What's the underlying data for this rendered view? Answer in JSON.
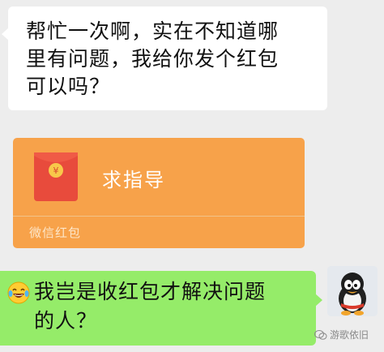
{
  "messages": {
    "incoming_text": "帮忙一次啊，实在不知道哪\n里有问题，我给你发个红包\n可以吗？",
    "red_packet": {
      "title": "求指导",
      "footer": "微信红包",
      "icon": "red-envelope-icon",
      "colors": {
        "card": "#f7a24a",
        "envelope": "#e84b3c",
        "coin": "#f8c84a"
      }
    },
    "outgoing": {
      "emoji": "tears-of-joy-emoji",
      "text": "我岂是收红包才解决问题\n的人？"
    }
  },
  "colors": {
    "background": "#ededed",
    "incoming_bubble": "#ffffff",
    "outgoing_bubble": "#95ec69"
  },
  "avatar": {
    "icon": "penguin-avatar"
  },
  "watermark": {
    "icon": "wechat-icon",
    "text": "游歌依旧"
  }
}
